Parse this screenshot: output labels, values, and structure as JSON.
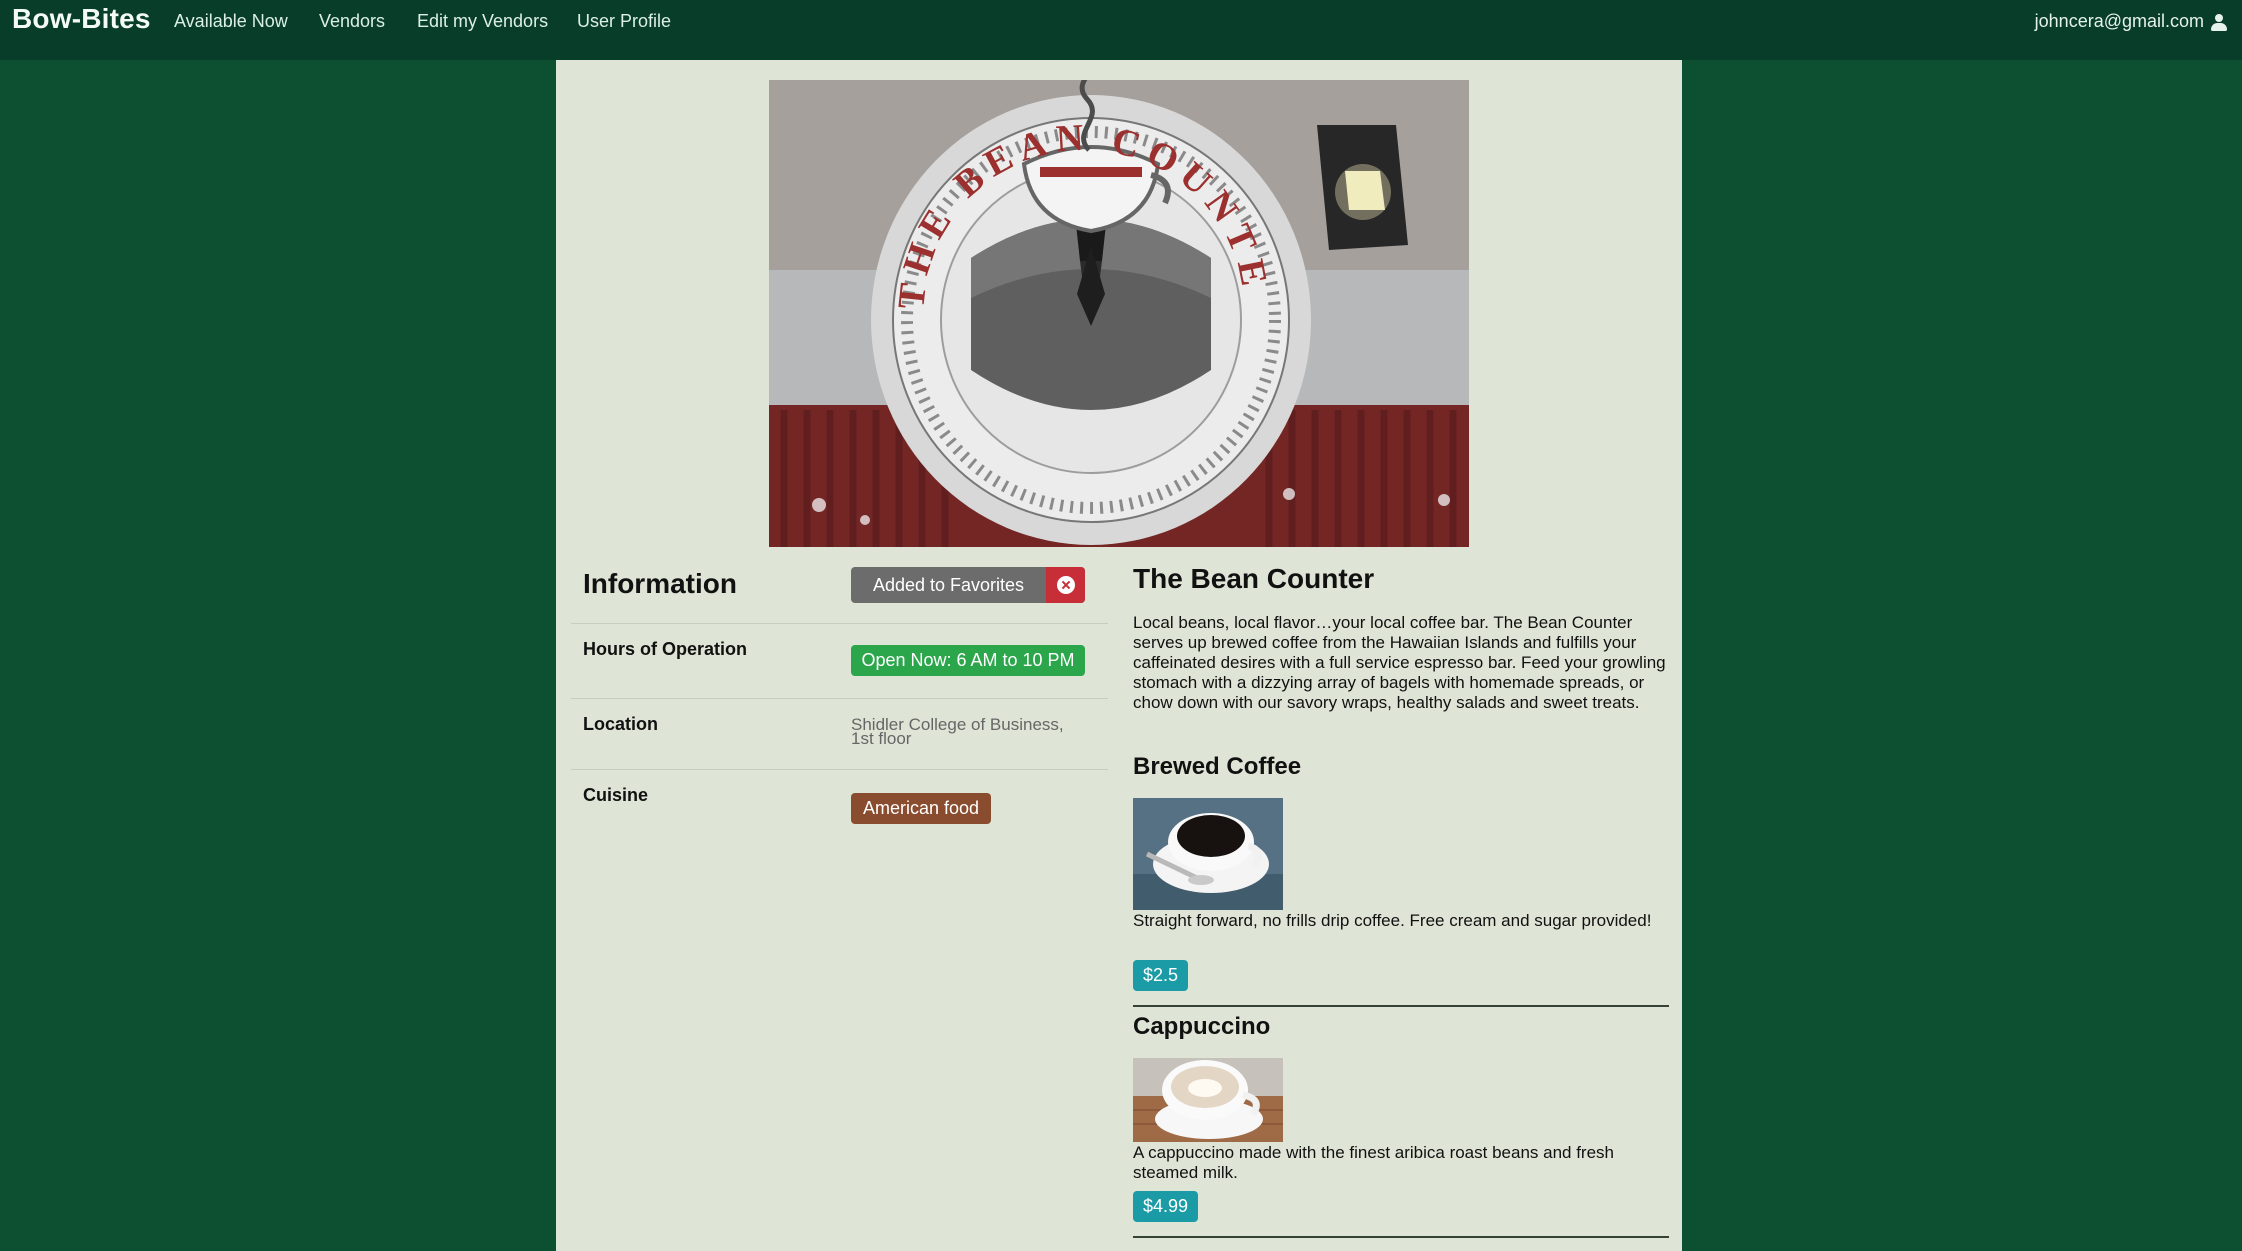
{
  "navbar": {
    "brand": "Bow-Bites",
    "links": [
      {
        "label": "Available Now"
      },
      {
        "label": "Vendors"
      },
      {
        "label": "Edit my Vendors"
      },
      {
        "label": "User Profile"
      }
    ],
    "user_email": "johncera@gmail.com",
    "user_icon": "user-icon"
  },
  "hero": {
    "sign_text": "THE BEAN COUNTER"
  },
  "info": {
    "title": "Information",
    "favorite_button_label": "Added to Favorites",
    "favorite_remove_icon": "x-circle-icon",
    "hours_label": "Hours of Operation",
    "hours_value": "Open Now: 6 AM to 10 PM",
    "location_label": "Location",
    "location_value": "Shidler College of Business, 1st floor",
    "cuisine_label": "Cuisine",
    "cuisine_value": "American food"
  },
  "vendor": {
    "name": "The Bean Counter",
    "description": "Local beans, local flavor…your local coffee bar. The Bean Counter serves up brewed coffee from the Hawaiian Islands and fulfills your caffeinated desires with a full service espresso bar. Feed your growling stomach with a dizzying array of bagels with homemade spreads, or chow down with our savory wraps, healthy salads and sweet treats."
  },
  "menu": [
    {
      "name": "Brewed Coffee",
      "description": "Straight forward, no frills drip coffee. Free cream and sugar provided!",
      "price": "$2.5"
    },
    {
      "name": "Cappuccino",
      "description": "A cappuccino made with the finest aribica roast beans and fresh steamed milk.",
      "price": "$4.99"
    }
  ],
  "colors": {
    "page_background": "#0d4f31",
    "navbar_background": "#073d29",
    "panel_background": "#dfe5d6",
    "favorite_button": "#6c6c6c",
    "remove_button": "#c72e38",
    "open_badge": "#2ba64b",
    "cuisine_badge": "#8a4c2e",
    "price_badge": "#1b9ba6"
  }
}
